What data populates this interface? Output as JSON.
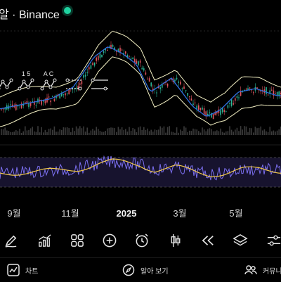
{
  "header": {
    "title": "알 · Binance",
    "live_color": "#1fd3a0"
  },
  "chart": {
    "x_axis_labels": [
      "9월",
      "11월",
      "2025",
      "3월",
      "5월"
    ],
    "drawing_toolbar": {
      "tools": [
        {
          "name": "pattern-tool-icon",
          "label": "",
          "glyph": "zigzag"
        },
        {
          "name": "five-wave-tool-icon",
          "label": "1 5",
          "glyph": "zigzag"
        },
        {
          "name": "abc-wave-tool-icon",
          "label": "A C",
          "glyph": "zigzag"
        },
        {
          "name": "dotted-lines-tool-icon",
          "label": "",
          "glyph": "lines"
        },
        {
          "name": "horizontal-lines-tool-icon",
          "label": "",
          "glyph": "lines"
        }
      ]
    },
    "colors": {
      "bollinger": "#f4f1c4",
      "moving_average": "#2f6fe0",
      "up": "#2bb596",
      "down": "#e0555f",
      "rsi": "#7b6ff0",
      "rsi_ma": "#f2c94c"
    }
  },
  "toolbar": {
    "icons": [
      "pen-icon",
      "indicators-icon",
      "grid-icon",
      "add-icon",
      "alarm-icon",
      "candles-icon",
      "rewind-icon",
      "layers-icon",
      "settings-sliders-icon"
    ]
  },
  "bottom_nav": {
    "chart": "차트",
    "explore": "알아 보기",
    "community": "커뮤니티"
  }
}
